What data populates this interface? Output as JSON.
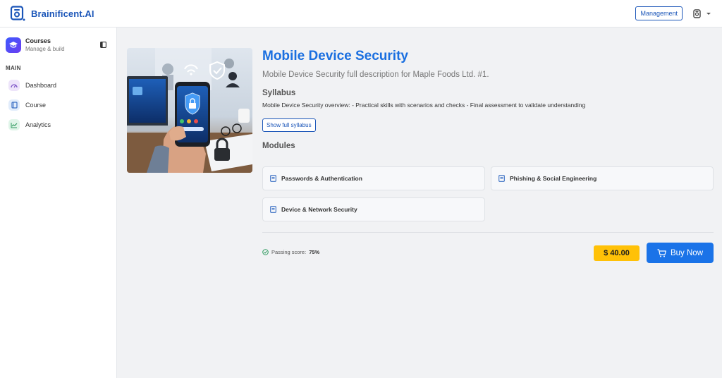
{
  "brand": {
    "name": "Brainificent.AI"
  },
  "header": {
    "management_label": "Management"
  },
  "sidebar": {
    "title": "Courses",
    "subtitle": "Manage & build",
    "section_label": "MAIN",
    "items": [
      {
        "label": "Dashboard",
        "icon": "gauge-icon"
      },
      {
        "label": "Course",
        "icon": "book-icon"
      },
      {
        "label": "Analytics",
        "icon": "chart-line-icon"
      }
    ]
  },
  "course": {
    "title": "Mobile Device Security",
    "description": "Mobile Device Security full description for Maple Foods Ltd. #1.",
    "syllabus_heading": "Syllabus",
    "syllabus_text": "Mobile Device Security overview: - Practical skills with scenarios and checks - Final assessment to validate understanding",
    "show_syllabus_label": "Show full syllabus",
    "modules_heading": "Modules",
    "modules": [
      {
        "label": "Passwords & Authentication"
      },
      {
        "label": "Phishing & Social Engineering"
      },
      {
        "label": "Device & Network Security"
      }
    ],
    "passing_label": "Passing score:",
    "passing_value": "75%",
    "price": "$ 40.00",
    "buy_label": "Buy Now"
  },
  "colors": {
    "brand": "#1a55b8",
    "title": "#1a6fe0",
    "buy": "#1a73e8",
    "price": "#ffc107"
  }
}
